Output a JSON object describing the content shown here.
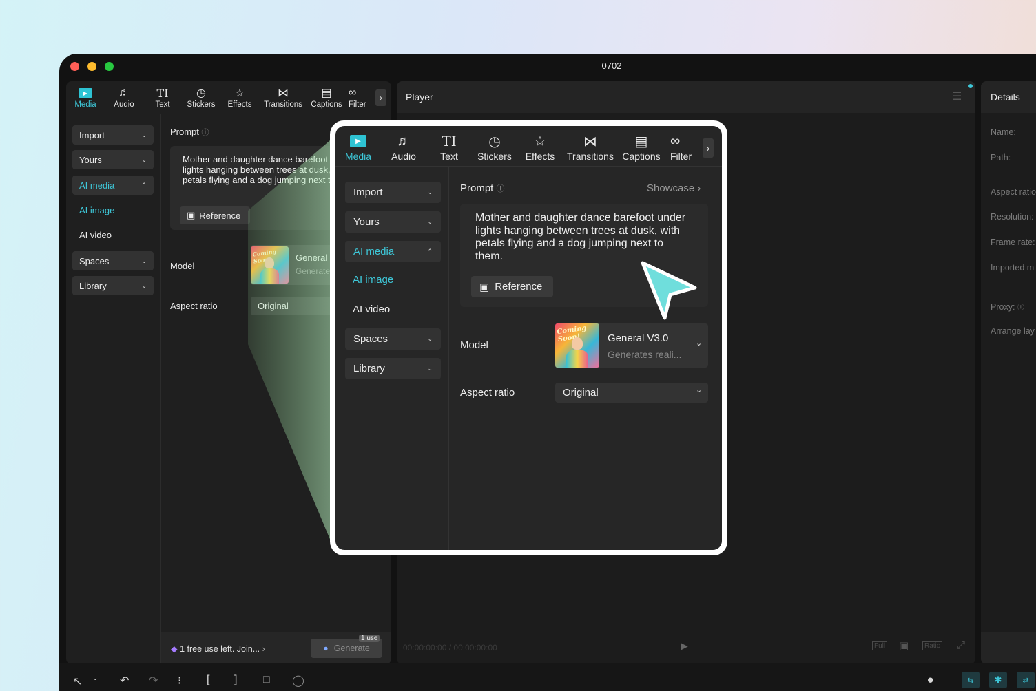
{
  "window": {
    "title": "0702",
    "traffic_colors": [
      "#ff5f57",
      "#febc2e",
      "#28c840"
    ]
  },
  "toolbar": {
    "tabs": [
      {
        "label": "Media",
        "icon": "media-icon",
        "active": true
      },
      {
        "label": "Audio",
        "icon": "audio-icon"
      },
      {
        "label": "Text",
        "icon": "text-icon"
      },
      {
        "label": "Stickers",
        "icon": "sticker-icon"
      },
      {
        "label": "Effects",
        "icon": "effects-icon"
      },
      {
        "label": "Transitions",
        "icon": "transitions-icon"
      },
      {
        "label": "Captions",
        "icon": "captions-icon"
      },
      {
        "label": "Filter",
        "icon": "filters-icon"
      }
    ],
    "more_icon": "chevron-right-icon"
  },
  "sidebar": {
    "import": "Import",
    "yours": "Yours",
    "ai_media": "AI media",
    "ai_image": "AI image",
    "ai_video": "AI video",
    "spaces": "Spaces",
    "library": "Library"
  },
  "ai_panel": {
    "prompt_label": "Prompt",
    "showcase": "Showcase",
    "prompt_text": "Mother and daughter dance barefoot under lights hanging between trees at dusk, with petals flying and a dog jumping next to them.",
    "reference_label": "Reference",
    "model_label": "Model",
    "model_name": "General V3.0",
    "model_desc": "Generates reali...",
    "model_name_short": "General",
    "model_desc_short": "Generate",
    "thumb_text": "Coming Soon!",
    "aspect_label": "Aspect ratio",
    "aspect_value": "Original"
  },
  "footer": {
    "free_use": "1 free use left. Join...",
    "generate": "Generate",
    "badge": "1 use"
  },
  "player": {
    "title": "Player",
    "timecode": "00:00:00:00 / 00:00:00:00",
    "full": "Full",
    "ratio": "Ratio"
  },
  "details": {
    "title": "Details",
    "name": "Name:",
    "path": "Path:",
    "aspect": "Aspect ratio",
    "resolution": "Resolution:",
    "frame_rate": "Frame rate:",
    "imported": "Imported m",
    "proxy": "Proxy:",
    "arrange": "Arrange lay"
  },
  "colors": {
    "accent": "#3ec7d8",
    "cursor": "#6fdedc"
  }
}
